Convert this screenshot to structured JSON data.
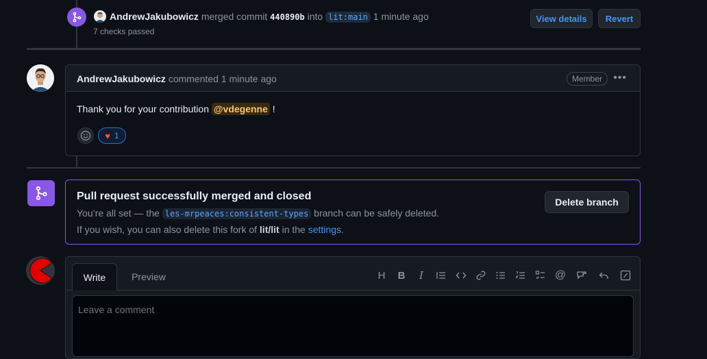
{
  "merge_event": {
    "user": "AndrewJakubowicz",
    "action": "merged commit",
    "sha": "440890b",
    "into": "into",
    "target_branch": "lit:main",
    "time": "1 minute ago",
    "checks": "7 checks passed",
    "view_details": "View details",
    "revert": "Revert"
  },
  "comment": {
    "user": "AndrewJakubowicz",
    "action": "commented",
    "time": "1 minute ago",
    "badge": "Member",
    "body_prefix": "Thank you for your contribution ",
    "mention": "@vdegenne",
    "body_suffix": " !",
    "heart_count": "1"
  },
  "merged_box": {
    "title": "Pull request successfully merged and closed",
    "line1_prefix": "You’re all set — the ",
    "branch": "les-mrpeaces:consistent-types",
    "line1_suffix": " branch can be safely deleted.",
    "line2_prefix": "If you wish, you can also delete this fork of ",
    "repo": "lit/lit",
    "line2_middle": " in the ",
    "settings_link": "settings",
    "line2_suffix": ".",
    "delete_button": "Delete branch"
  },
  "editor": {
    "tab_write": "Write",
    "tab_preview": "Preview",
    "placeholder": "Leave a comment",
    "toolbar": [
      "heading-icon",
      "bold-icon",
      "italic-icon",
      "quote-icon",
      "code-icon",
      "link-icon",
      "unordered-list-icon",
      "ordered-list-icon",
      "task-list-icon",
      "mention-icon",
      "cross-reference-icon",
      "reply-icon",
      "slash-commands-icon"
    ]
  },
  "colors": {
    "background": "#0d1117",
    "merged_purple": "#8957e5",
    "link_blue": "#4493f8",
    "border": "#30363d"
  }
}
